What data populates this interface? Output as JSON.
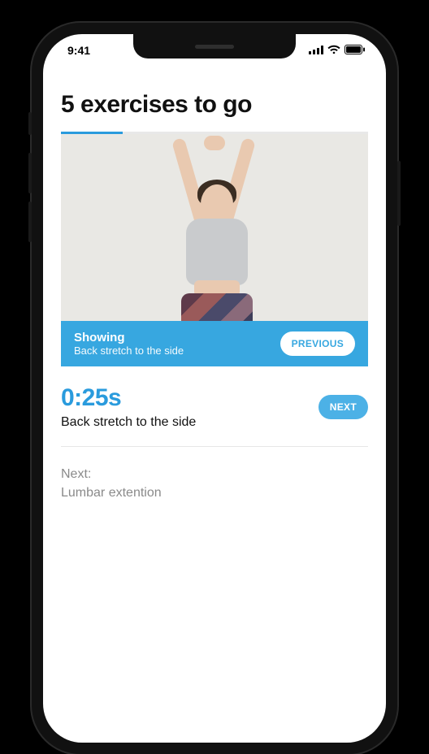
{
  "status": {
    "time": "9:41"
  },
  "title": "5 exercises to go",
  "progress_percent": 20,
  "showing": {
    "label": "Showing",
    "name": "Back stretch to the side",
    "prev_button": "PREVIOUS"
  },
  "current": {
    "timer": "0:25s",
    "name": "Back stretch to the side",
    "next_button": "NEXT"
  },
  "upnext": {
    "label": "Next:",
    "name": "Lumbar extention"
  },
  "colors": {
    "accent": "#37a7e0"
  }
}
